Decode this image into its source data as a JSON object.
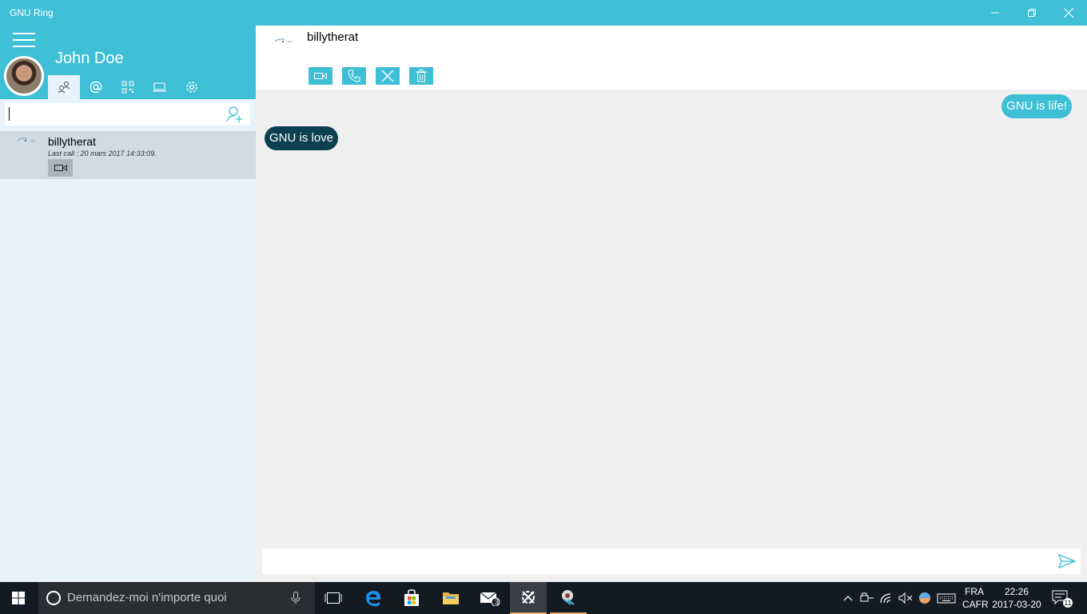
{
  "window": {
    "title": "GNU Ring"
  },
  "sidebar": {
    "user_name": "John Doe",
    "tabs": [
      "contacts",
      "account",
      "qr-code",
      "devices",
      "settings"
    ],
    "search": {
      "value": "",
      "placeholder": ""
    },
    "contacts": [
      {
        "name": "billytherat",
        "last_call": "Last call : 20 mars 2017 14:33:09."
      }
    ]
  },
  "chat": {
    "contact_name": "billytherat",
    "actions": [
      "video-call",
      "audio-call",
      "close",
      "delete"
    ],
    "messages": [
      {
        "text": "GNU is life!",
        "direction": "outgoing"
      },
      {
        "text": "GNU is love",
        "direction": "incoming"
      }
    ],
    "compose": {
      "value": "",
      "placeholder": ""
    }
  },
  "taskbar": {
    "search_placeholder": "Demandez-moi n'importe quoi",
    "mail_badge": "3",
    "lang_top": "FRA",
    "lang_bottom": "CAFR",
    "time": "22:26",
    "date": "2017-03-20",
    "notif_count": "11"
  },
  "colors": {
    "accent": "#3fbfd6",
    "incoming_bubble": "#0c4050",
    "sidebar_bg": "#e7f2fb",
    "selected_contact": "#d0dbe5"
  }
}
